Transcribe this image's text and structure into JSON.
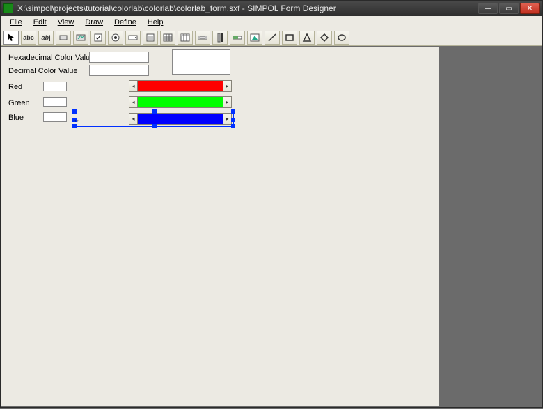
{
  "window": {
    "title": "X:\\simpol\\projects\\tutorial\\colorlab\\colorlab\\colorlab_form.sxf - SIMPOL Form Designer"
  },
  "menu": {
    "file": "File",
    "edit": "Edit",
    "view": "View",
    "draw": "Draw",
    "define": "Define",
    "help": "Help"
  },
  "toolbar": {
    "pointer": "pointer",
    "text_abc": "abc",
    "textbox_ab": "ab|",
    "button": "button",
    "bitmap_button": "bitmap-button",
    "checkbox": "checkbox",
    "option": "option",
    "combo": "combo",
    "listbox": "listbox",
    "grid": "grid",
    "datagrid": "datagrid",
    "scroll_h": "scroll-h",
    "scroll_v": "scroll-v",
    "gauge": "gauge",
    "image": "image",
    "line": "line",
    "rect": "rect",
    "triangle": "triangle",
    "diamond": "diamond",
    "ellipse": "ellipse"
  },
  "form": {
    "labels": {
      "hex": "Hexadecimal Color Value",
      "dec": "Decimal Color Value",
      "red": "Red",
      "green": "Green",
      "blue": "Blue"
    },
    "values": {
      "hex": "",
      "dec": "",
      "red": "",
      "green": "",
      "blue": ""
    },
    "colors": {
      "red": "#fe0000",
      "green": "#00ff00",
      "blue": "#0000fe"
    },
    "scroll_arrow_left": "◂",
    "scroll_arrow_right": "▸"
  },
  "win_controls": {
    "min": "—",
    "max": "▭",
    "close": "✕"
  }
}
